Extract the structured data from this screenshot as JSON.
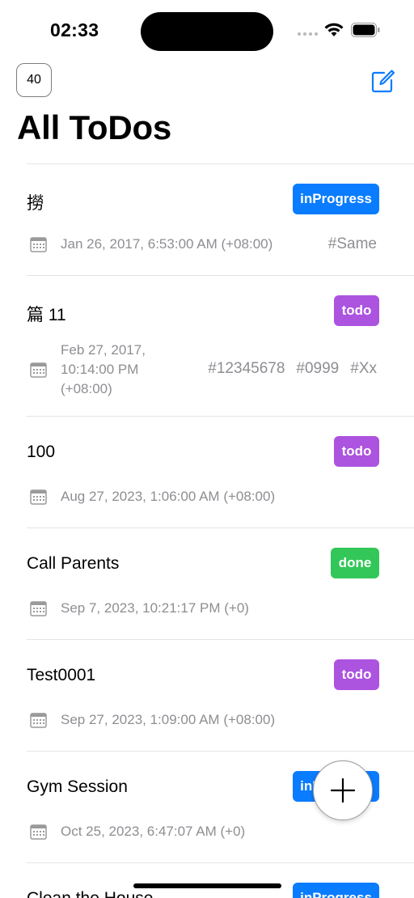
{
  "status_bar": {
    "time": "02:33"
  },
  "nav": {
    "count_badge": "40",
    "title": "All ToDos"
  },
  "todos": [
    {
      "title": "撈",
      "status": "inProgress",
      "date": "Jan 26, 2017, 6:53:00 AM (+08:00)",
      "tags": [
        "#Same"
      ]
    },
    {
      "title": "篇 11",
      "status": "todo",
      "date_lines": [
        "Feb 27, 2017,",
        "10:14:00 PM",
        "(+08:00)"
      ],
      "tags": [
        "#12345678",
        "#0999",
        "#Xx"
      ]
    },
    {
      "title": "100",
      "status": "todo",
      "date": "Aug 27, 2023, 1:06:00 AM (+08:00)",
      "tags": []
    },
    {
      "title": "Call Parents",
      "status": "done",
      "date": "Sep 7, 2023, 10:21:17 PM (+0)",
      "tags": []
    },
    {
      "title": "Test0001",
      "status": "todo",
      "date": "Sep 27, 2023, 1:09:00 AM (+08:00)",
      "tags": []
    },
    {
      "title": "Gym Session",
      "status": "inProgress",
      "date": "Oct 25, 2023, 6:47:07 AM (+0)",
      "tags": []
    },
    {
      "title": "Clean the House",
      "status": "inProgress",
      "date": "",
      "tags": []
    }
  ],
  "colors": {
    "inProgress": "#0a7cff",
    "todo": "#ac53e0",
    "done": "#33c759",
    "accent": "#0a7cff"
  }
}
